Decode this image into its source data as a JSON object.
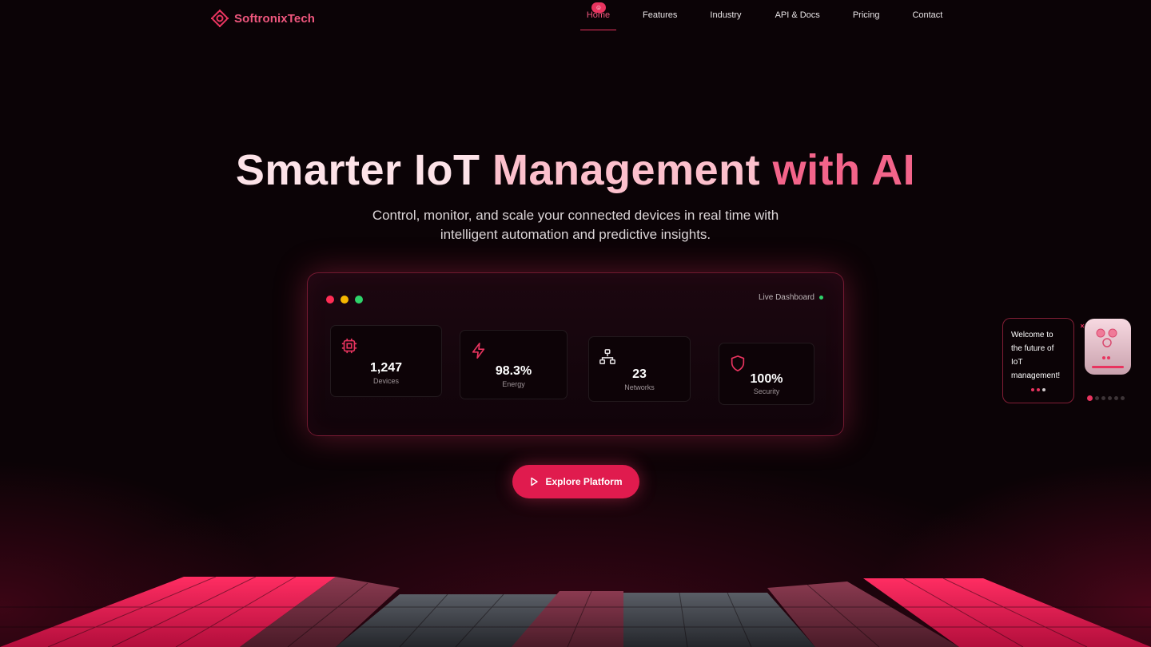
{
  "brand": {
    "name": "SoftronixTech",
    "icon": "chip-logo-icon"
  },
  "nav": {
    "items": [
      "Home",
      "Features",
      "Industry",
      "API & Docs",
      "Pricing",
      "Contact"
    ],
    "active": "Home"
  },
  "hero": {
    "title_part1": "Smarter IoT",
    "title_part2": "Management",
    "title_part3": "with AI",
    "subtitle_line1": "Control, monitor, and scale your connected devices in real time with",
    "subtitle_line2": "intelligent automation and predictive insights."
  },
  "dashboard": {
    "live_label": "Live Dashboard",
    "window_dots": [
      "#ff2d55",
      "#f5b700",
      "#2ed36a"
    ],
    "cards": [
      {
        "icon": "chip-icon",
        "value": "1,247",
        "label": "Devices"
      },
      {
        "icon": "lightning-icon",
        "value": "98.3%",
        "label": "Energy"
      },
      {
        "icon": "network-icon",
        "value": "23",
        "label": "Networks"
      },
      {
        "icon": "shield-icon",
        "value": "100%",
        "label": "Security"
      }
    ]
  },
  "cta": {
    "label": "Explore Platform",
    "icon": "play-icon"
  },
  "chat": {
    "message": "Welcome to the future of IoT management!",
    "avatar": "robot-icon",
    "page_count": 6,
    "active_page": 1
  },
  "colors": {
    "accent": "#e8345f",
    "background": "#0b0306",
    "success": "#2ed36a"
  }
}
